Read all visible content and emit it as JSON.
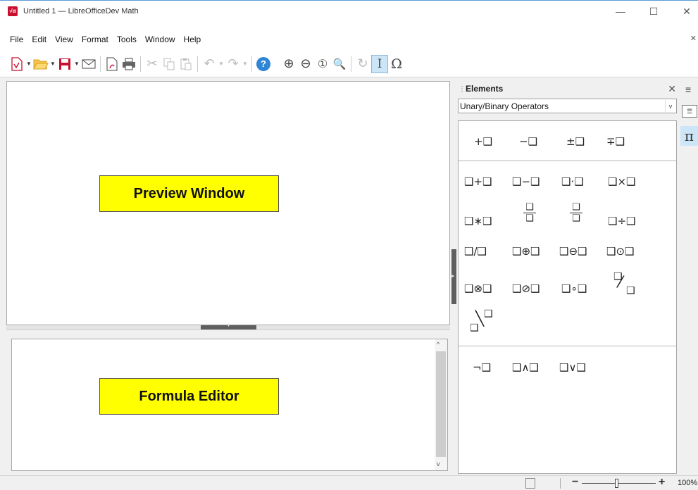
{
  "window": {
    "title": "Untitled 1 — LibreOfficeDev Math",
    "app_icon": "√α",
    "minimize": "—",
    "maximize": "☐",
    "close": "✕"
  },
  "menu": {
    "items": [
      "File",
      "Edit",
      "View",
      "Format",
      "Tools",
      "Window",
      "Help"
    ],
    "close": "✕"
  },
  "toolbar": {
    "help": "?",
    "zoom_in": "⊕",
    "zoom_out": "⊖",
    "zoom_100": "①",
    "show_all": "🔍",
    "update": "↻",
    "formula_cursor": "I",
    "symbols": "Ω"
  },
  "preview": {
    "callout": "Preview Window"
  },
  "editor": {
    "callout": "Formula Editor",
    "scroll_up": "^",
    "scroll_down": "v"
  },
  "elements_panel": {
    "title": "Elements",
    "close": "✕",
    "category": "Unary/Binary Operators",
    "dropdown_arrow": "v",
    "unary": [
      "+❑",
      "−❑",
      "±❑",
      "∓❑"
    ],
    "binary_row1": [
      "❑+❑",
      "❑−❑",
      "❑·❑",
      "❑×❑"
    ],
    "binary_row2": [
      "❑∗❑",
      "❑",
      "❑",
      "❑",
      "❑",
      "❑÷❑"
    ],
    "binary_row3": [
      "❑/❑",
      "❑⊕❑",
      "❑⊖❑",
      "❑⊙❑"
    ],
    "binary_row4": [
      "❑⊗❑",
      "❑⊘❑",
      "❑∘❑"
    ],
    "slash_frac": [
      "❑",
      "⁄",
      "❑"
    ],
    "backslash_frac": [
      "❑",
      "╲",
      "❑"
    ],
    "logic": [
      "¬❑",
      "❑∧❑",
      "❑∨❑"
    ]
  },
  "sidebar_tabs": {
    "menu": "≡",
    "properties": "☰",
    "elements": "π"
  },
  "statusbar": {
    "zoom_minus": "−",
    "zoom_plus": "+",
    "zoom": "100%",
    "zoom_level": 0.47
  }
}
